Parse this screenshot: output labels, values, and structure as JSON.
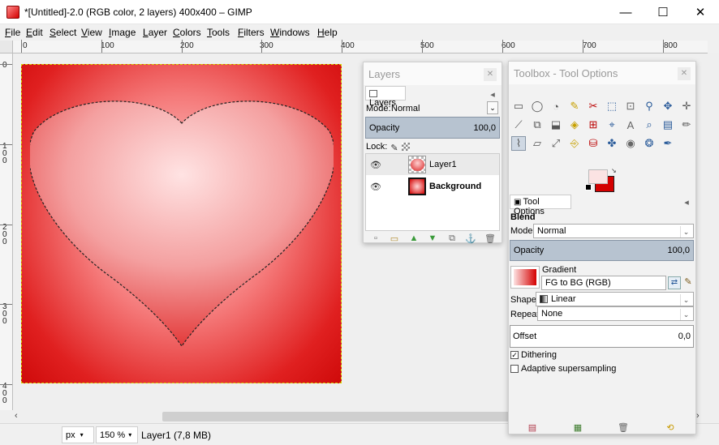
{
  "window": {
    "title": "*[Untitled]-2.0 (RGB color, 2 layers) 400x400 – GIMP",
    "minimize": "—",
    "maximize": "☐",
    "close": "✕"
  },
  "menu": [
    "File",
    "Edit",
    "Select",
    "View",
    "Image",
    "Layer",
    "Colors",
    "Tools",
    "Filters",
    "Windows",
    "Help"
  ],
  "ruler_h": [
    "0",
    "100",
    "200",
    "300",
    "400",
    "500",
    "600",
    "700",
    "800"
  ],
  "ruler_v": [
    "0",
    "100",
    "200",
    "300",
    "400"
  ],
  "layers_dock": {
    "title": "Layers",
    "tab": "Layers",
    "mode_label": "Mode:",
    "mode": "Normal",
    "opacity_label": "Opacity",
    "opacity": "100,0",
    "lock_label": "Lock:",
    "layers": [
      {
        "name": "Layer1",
        "visible": true,
        "bold": false
      },
      {
        "name": "Background",
        "visible": true,
        "bold": true
      }
    ],
    "bottom_icons": [
      "new-layer-icon",
      "new-group-icon",
      "raise-icon",
      "lower-icon",
      "duplicate-icon",
      "anchor-icon",
      "delete-icon"
    ]
  },
  "toolbox": {
    "title": "Toolbox - Tool Options",
    "tools": [
      "▭",
      "◯",
      "◔",
      "✎",
      "✂",
      "⬚",
      "⊡",
      "⚲",
      "✥",
      "✛",
      "⟋",
      "⧉",
      "⬓",
      "◈",
      "⊞",
      "⌖",
      "A",
      "⌕",
      "▤",
      "✏",
      "⌇",
      "▱",
      "⤢",
      "⎆",
      "⛁",
      "✤",
      "◉",
      "❂",
      "✒"
    ],
    "tool_options_tab": "Tool Options",
    "tool_name": "Blend",
    "mode_label": "Mode:",
    "mode": "Normal",
    "opacity_label": "Opacity",
    "opacity": "100,0",
    "gradient_label": "Gradient",
    "gradient": "FG to BG (RGB)",
    "shape_label": "Shape:",
    "shape": "Linear",
    "repeat_label": "Repeat:",
    "repeat": "None",
    "offset_label": "Offset",
    "offset": "0,0",
    "dithering_label": "Dithering",
    "dithering_checked": true,
    "adaptive_label": "Adaptive supersampling",
    "adaptive_checked": false,
    "fg_color": "#fbe3e3",
    "bg_color": "#d40000"
  },
  "status": {
    "unit": "px",
    "zoom": "150 %",
    "layer_info": "Layer1 (7,8 MB)"
  }
}
